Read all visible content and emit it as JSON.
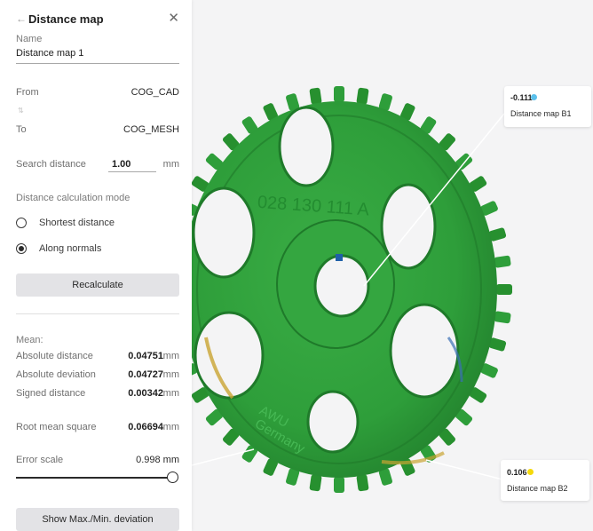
{
  "panel": {
    "title": "Distance map",
    "name_label": "Name",
    "name_value": "Distance map 1",
    "from_label": "From",
    "from_value": "COG_CAD",
    "to_label": "To",
    "to_value": "COG_MESH",
    "search_distance_label": "Search distance",
    "search_distance_value": "1.00",
    "search_distance_unit": "mm",
    "mode_label": "Distance calculation mode",
    "mode_options": [
      {
        "label": "Shortest distance",
        "selected": false
      },
      {
        "label": "Along normals",
        "selected": true
      }
    ],
    "recalculate_label": "Recalculate",
    "mean_label": "Mean:",
    "stats": [
      {
        "label": "Absolute distance",
        "value": "0.04751",
        "unit": "mm"
      },
      {
        "label": "Absolute deviation",
        "value": "0.04727",
        "unit": "mm"
      },
      {
        "label": "Signed distance",
        "value": "0.00342",
        "unit": "mm"
      }
    ],
    "rms": {
      "label": "Root mean square",
      "value": "0.06694",
      "unit": "mm"
    },
    "error_scale": {
      "label": "Error scale",
      "value": "0.998 mm",
      "level": 1.0
    },
    "show_deviation_label": "Show Max./Min. deviation"
  },
  "viewport": {
    "part_markings": [
      "028 130 111 A",
      "AWU",
      "Germany"
    ],
    "callouts": [
      {
        "value": "-0.111",
        "name": "Distance map B1",
        "dot_color": "#5bc0eb"
      },
      {
        "value": "0.106",
        "name": "Distance map B2",
        "dot_color": "#f5d90a"
      }
    ]
  },
  "colors": {
    "gear_green": "#2e9e3a",
    "gear_dark": "#1f7a2a",
    "accent_dark": "#2a2a2a"
  }
}
